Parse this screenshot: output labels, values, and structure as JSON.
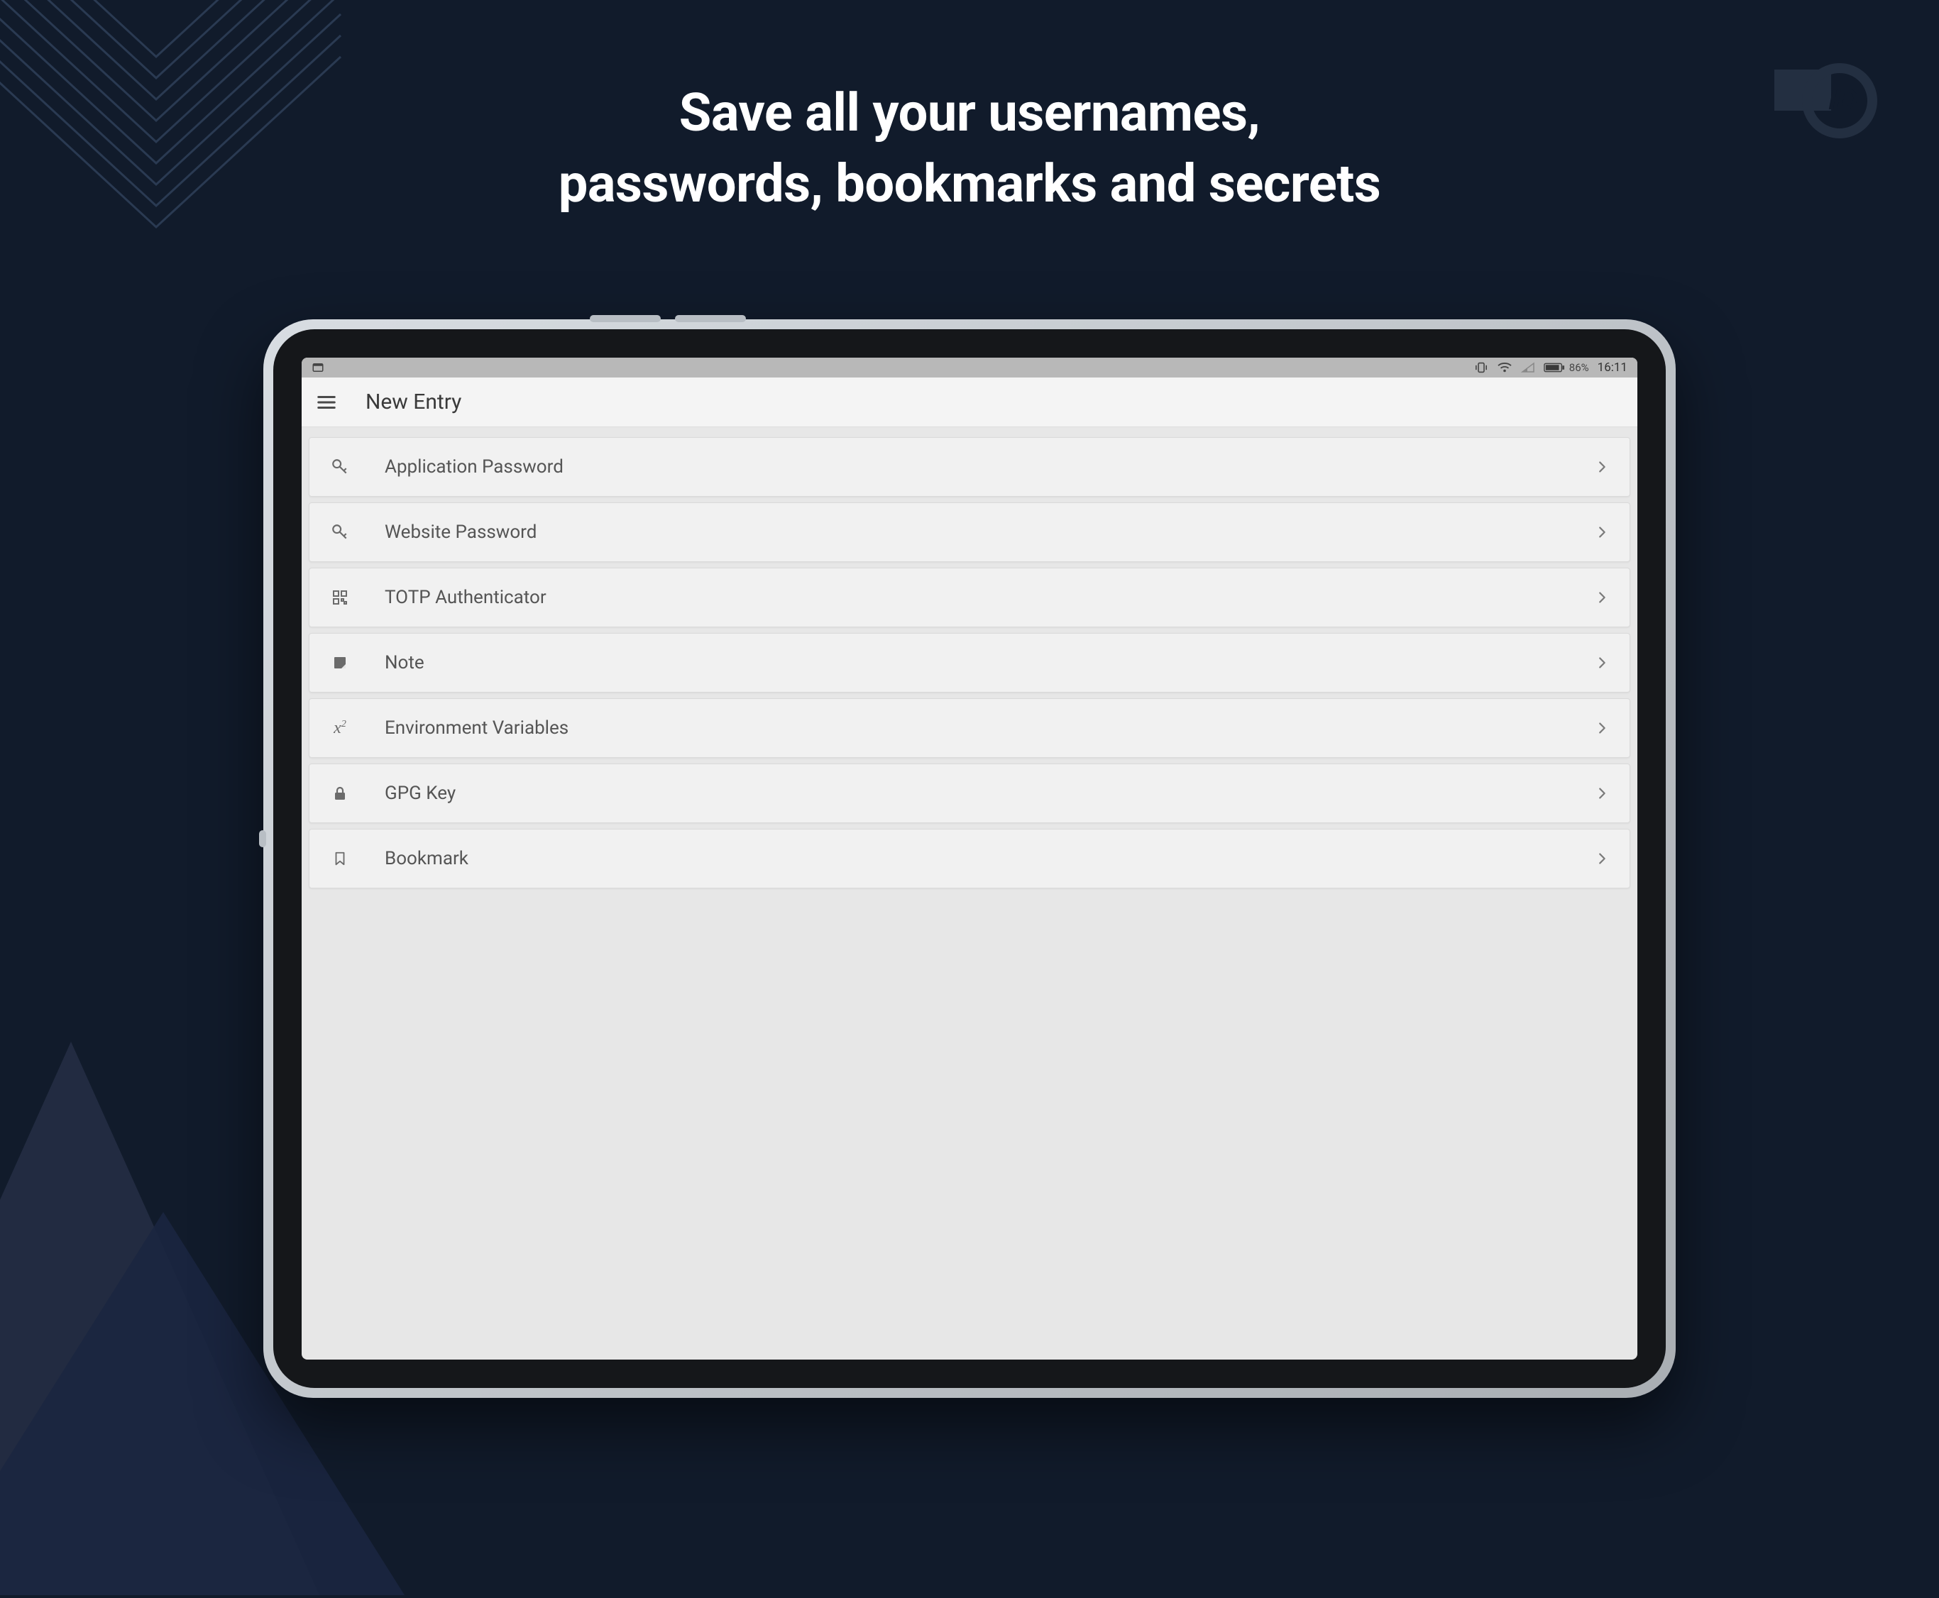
{
  "headline": "Save all your usernames,\npasswords, bookmarks and secrets",
  "statusbar": {
    "battery_percent": "86%",
    "time": "16:11"
  },
  "app": {
    "title": "New Entry"
  },
  "entries": [
    {
      "icon": "key-icon",
      "label": "Application Password"
    },
    {
      "icon": "key-icon",
      "label": "Website Password"
    },
    {
      "icon": "qr-icon",
      "label": "TOTP Authenticator"
    },
    {
      "icon": "note-icon",
      "label": "Note"
    },
    {
      "icon": "variable-icon",
      "label": "Environment Variables"
    },
    {
      "icon": "lock-icon",
      "label": "GPG Key"
    },
    {
      "icon": "bookmark-icon",
      "label": "Bookmark"
    }
  ]
}
